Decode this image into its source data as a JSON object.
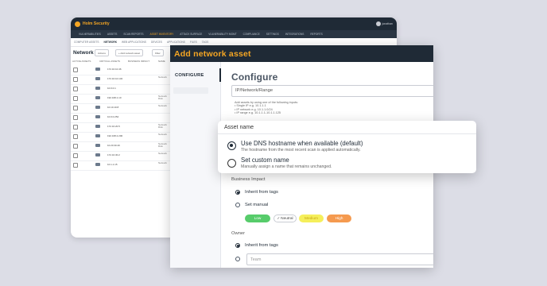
{
  "bg_app": {
    "logo": "Holm Security",
    "user": "jonathan",
    "nav": [
      "VULNERABILITIES",
      "ASSETS",
      "SCAN REPORTS",
      "ASSET INVENTORY",
      "ATTACK SURFACE",
      "VULNERABILITY MGMT",
      "COMPLIANCE",
      "SETTINGS",
      "INTEGRATIONS",
      "REPORTS"
    ],
    "subnav": [
      "COMPUTER ASSETS",
      "NETWORK",
      "WEB APPLICATIONS",
      "DEVICES",
      "APPLICATIONS",
      "FILES",
      "TAGS"
    ],
    "page_title": "Network",
    "toolbar": [
      "Actions",
      "+ Add network asset",
      "Filter"
    ],
    "columns": [
      "ACTIVE ASSETS",
      "CRITICAL ASSETS",
      "BUSINESS IMPACT",
      "NAME"
    ],
    "rows": [
      {
        "name": "172.16.10.46",
        "extra": ""
      },
      {
        "name": "172.16.10.132",
        "extra": "Network"
      },
      {
        "name": "10.0.0.1",
        "extra": ""
      },
      {
        "name": "192.168.1.10",
        "extra": "Network\nRisk"
      },
      {
        "name": "10.10.10.8",
        "extra": "Network"
      },
      {
        "name": "10.0.0.254",
        "extra": ""
      },
      {
        "name": "172.16.20.5",
        "extra": "Network\nRisk"
      },
      {
        "name": "192.168.2.200",
        "extra": "Network"
      },
      {
        "name": "10.20.30.40",
        "extra": "Network\nRisk"
      },
      {
        "name": "172.16.30.2",
        "extra": "Network"
      },
      {
        "name": "10.1.1.15",
        "extra": "Network"
      }
    ]
  },
  "modal": {
    "title": "Add network asset",
    "sidebar_item": "CONFIGURE",
    "heading": "Configure",
    "input_placeholder": "IP/Network/Range",
    "help": {
      "intro": "Add assets by using one of the following inputs:",
      "l1": "• Single IP e.g. 10.1.1.1",
      "l2": "• IP network e.g. 10.1.1.0/24",
      "l3": "• IP range e.g. 10.1.1.1-10.1.1.125"
    },
    "business_impact": {
      "label": "Business Impact",
      "opt_inherit": "Inherit from tags",
      "opt_manual": "Set manual",
      "levels": [
        "Low",
        "Neutral",
        "Medium",
        "High"
      ],
      "selected_level": "Neutral"
    },
    "owner": {
      "label": "Owner",
      "opt_inherit": "Inherit from tags",
      "team_placeholder": "Team"
    }
  },
  "asset_name_card": {
    "title": "Asset name",
    "option1_label": "Use DNS hostname when available (default)",
    "option1_desc": "The hostname from the most recent scan is applied automatically.",
    "option2_label": "Set custom name",
    "option2_desc": "Manually assign a name that remains unchanged.",
    "selected": "option1"
  },
  "colors": {
    "navy": "#1f2a36",
    "accent": "#f5a623",
    "low": "#57cc6b",
    "medium": "#f5ef5b",
    "high": "#f59a4f"
  }
}
